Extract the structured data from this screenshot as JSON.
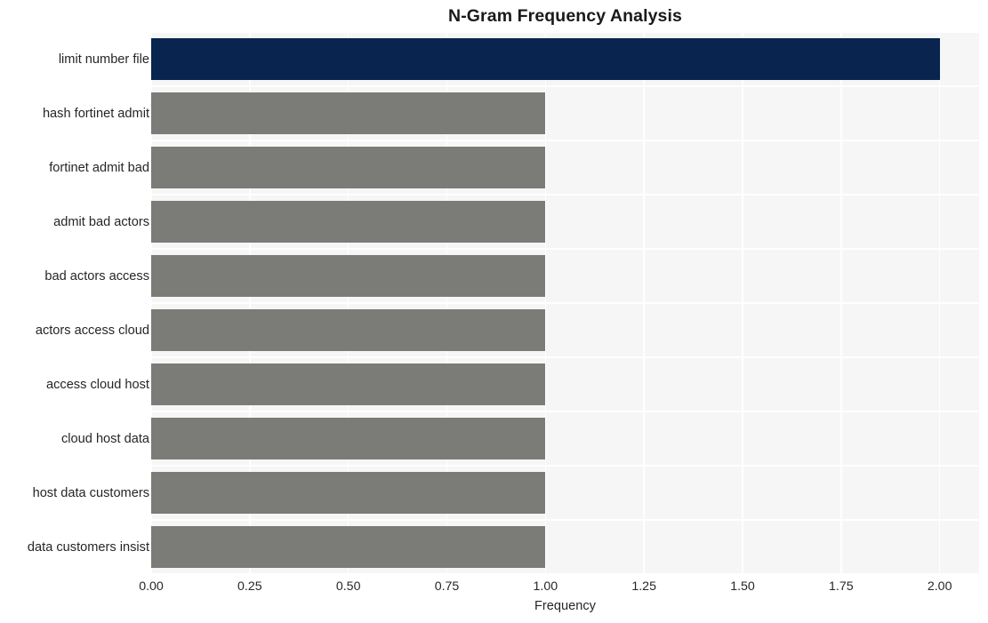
{
  "chart_data": {
    "type": "bar",
    "orientation": "horizontal",
    "title": "N-Gram Frequency Analysis",
    "xlabel": "Frequency",
    "ylabel": "",
    "categories": [
      "limit number file",
      "hash fortinet admit",
      "fortinet admit bad",
      "admit bad actors",
      "bad actors access",
      "actors access cloud",
      "access cloud host",
      "cloud host data",
      "host data customers",
      "data customers insist"
    ],
    "values": [
      2,
      1,
      1,
      1,
      1,
      1,
      1,
      1,
      1,
      1
    ],
    "xlim": [
      0,
      2.1
    ],
    "xticks": [
      0,
      0.25,
      0.5,
      0.75,
      1.0,
      1.25,
      1.5,
      1.75,
      2.0
    ],
    "xticklabels": [
      "0.00",
      "0.25",
      "0.50",
      "0.75",
      "1.00",
      "1.25",
      "1.50",
      "1.75",
      "2.00"
    ],
    "grid": true,
    "legend": false,
    "bar_colors": [
      "#08244f",
      "#7b7b78",
      "#7b7b78",
      "#7b7b78",
      "#7b7b78",
      "#7b7b78",
      "#7b7b78",
      "#7b7b78",
      "#7b7b78",
      "#7b7b78"
    ],
    "plot_background": "#f6f6f6",
    "grid_color": "#ffffff",
    "figure_background": "#ffffff",
    "highlight_color": "#08244f",
    "default_bar_color": "#7b7b78"
  }
}
